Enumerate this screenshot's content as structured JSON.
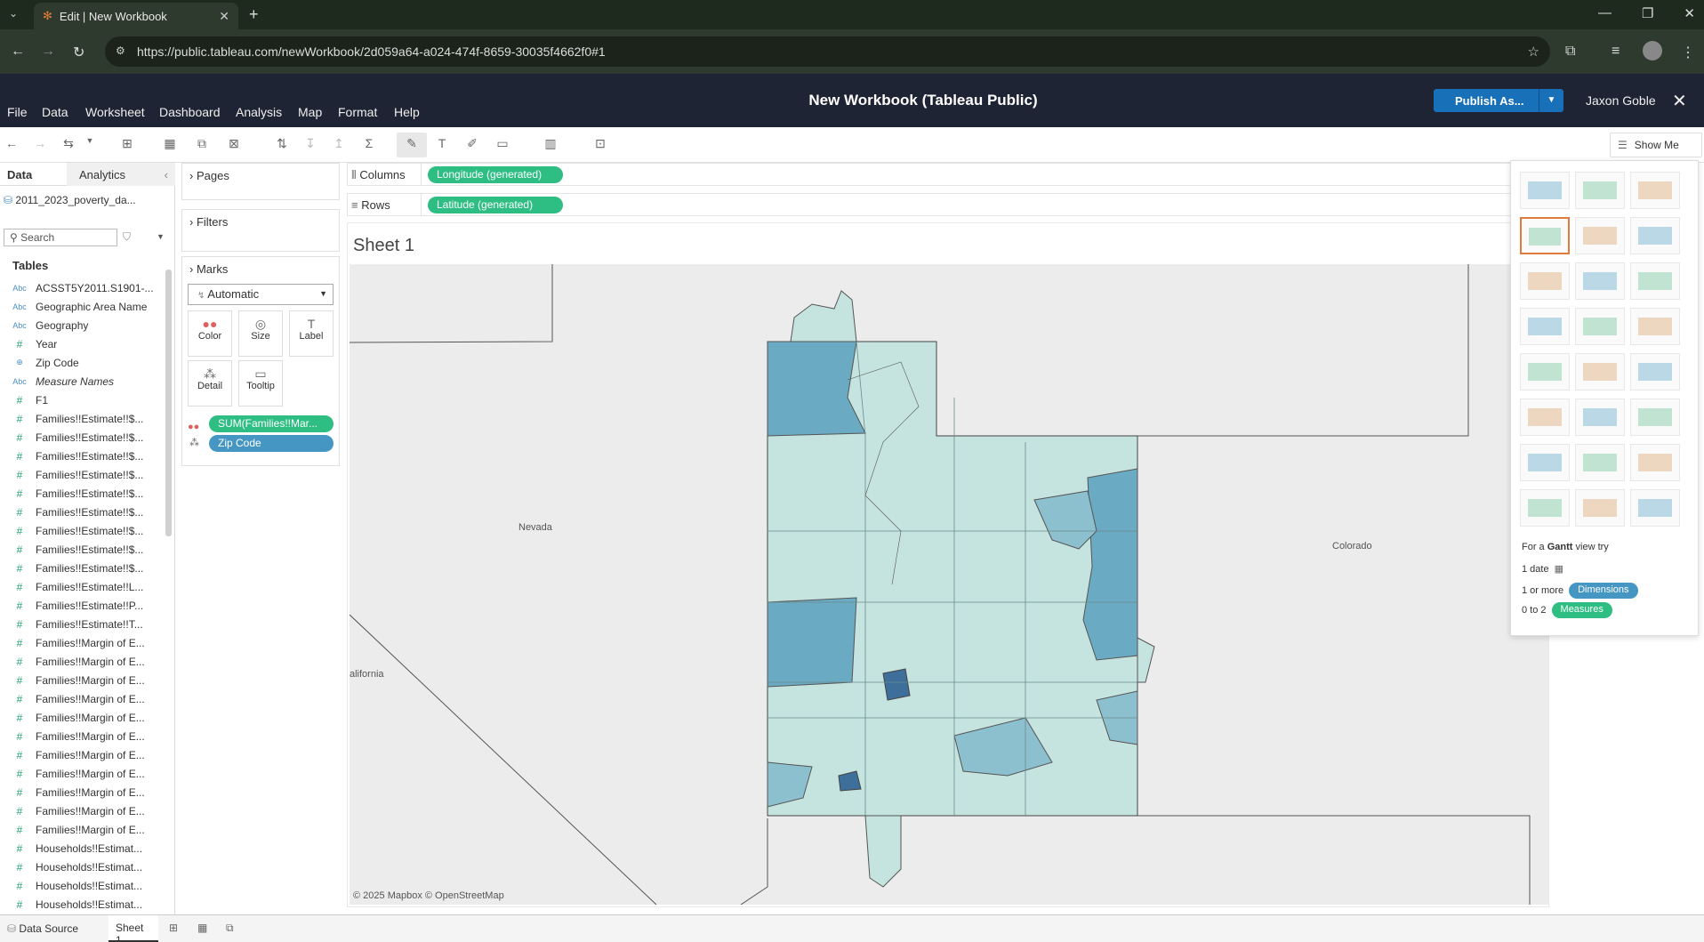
{
  "browser": {
    "tab_title": "Edit | New Workbook",
    "url": "https://public.tableau.com/newWorkbook/2d059a64-a024-474f-8659-30035f4662f0#1"
  },
  "header": {
    "menus": [
      "File",
      "Data",
      "Worksheet",
      "Dashboard",
      "Analysis",
      "Map",
      "Format",
      "Help"
    ],
    "title": "New Workbook (Tableau Public)",
    "publish_label": "Publish As...",
    "user": "Jaxon Goble"
  },
  "toolbar": {
    "show_me_label": "Show Me"
  },
  "data_pane": {
    "data_tab": "Data",
    "analytics_tab": "Analytics",
    "datasource": "2011_2023_poverty_da...",
    "search_placeholder": "Search",
    "tables_heading": "Tables",
    "fields": [
      {
        "type": "Abc",
        "name": "ACSST5Y2011.S1901-..."
      },
      {
        "type": "Abc",
        "name": "Geographic Area Name"
      },
      {
        "type": "Abc",
        "name": "Geography"
      },
      {
        "type": "#",
        "name": "Year"
      },
      {
        "type": "⊕",
        "name": "Zip Code"
      },
      {
        "type": "Abc",
        "name": "Measure Names"
      },
      {
        "type": "#",
        "name": "F1"
      },
      {
        "type": "#",
        "name": "Families!!Estimate!!$..."
      },
      {
        "type": "#",
        "name": "Families!!Estimate!!$..."
      },
      {
        "type": "#",
        "name": "Families!!Estimate!!$..."
      },
      {
        "type": "#",
        "name": "Families!!Estimate!!$..."
      },
      {
        "type": "#",
        "name": "Families!!Estimate!!$..."
      },
      {
        "type": "#",
        "name": "Families!!Estimate!!$..."
      },
      {
        "type": "#",
        "name": "Families!!Estimate!!$..."
      },
      {
        "type": "#",
        "name": "Families!!Estimate!!$..."
      },
      {
        "type": "#",
        "name": "Families!!Estimate!!$..."
      },
      {
        "type": "#",
        "name": "Families!!Estimate!!L..."
      },
      {
        "type": "#",
        "name": "Families!!Estimate!!P..."
      },
      {
        "type": "#",
        "name": "Families!!Estimate!!T..."
      },
      {
        "type": "#",
        "name": "Families!!Margin of E..."
      },
      {
        "type": "#",
        "name": "Families!!Margin of E..."
      },
      {
        "type": "#",
        "name": "Families!!Margin of E..."
      },
      {
        "type": "#",
        "name": "Families!!Margin of E..."
      },
      {
        "type": "#",
        "name": "Families!!Margin of E..."
      },
      {
        "type": "#",
        "name": "Families!!Margin of E..."
      },
      {
        "type": "#",
        "name": "Families!!Margin of E..."
      },
      {
        "type": "#",
        "name": "Families!!Margin of E..."
      },
      {
        "type": "#",
        "name": "Families!!Margin of E..."
      },
      {
        "type": "#",
        "name": "Families!!Margin of E..."
      },
      {
        "type": "#",
        "name": "Families!!Margin of E..."
      },
      {
        "type": "#",
        "name": "Households!!Estimat..."
      },
      {
        "type": "#",
        "name": "Households!!Estimat..."
      },
      {
        "type": "#",
        "name": "Households!!Estimat..."
      },
      {
        "type": "#",
        "name": "Households!!Estimat..."
      }
    ]
  },
  "cards": {
    "pages": "Pages",
    "filters": "Filters",
    "marks": "Marks",
    "mark_type": "Automatic",
    "buttons": {
      "color": "Color",
      "size": "Size",
      "label": "Label",
      "detail": "Detail",
      "tooltip": "Tooltip"
    },
    "color_pill": "SUM(Families!!Mar...",
    "detail_pill": "Zip Code"
  },
  "shelves": {
    "columns_label": "Columns",
    "columns_pill": "Longitude (generated)",
    "rows_label": "Rows",
    "rows_pill": "Latitude (generated)"
  },
  "view": {
    "sheet_title": "Sheet 1",
    "labels": {
      "nevada": "Nevada",
      "colorado": "Colorado",
      "california": "alifornia"
    },
    "attribution": "© 2025 Mapbox  © OpenStreetMap"
  },
  "show_me": {
    "hint_prefix": "For a ",
    "hint_bold": "Gantt",
    "hint_suffix": " view try",
    "row1": "1 date",
    "row2_prefix": "1 or more",
    "row2_pill": "Dimensions",
    "row3_prefix": "0 to 2",
    "row3_pill": "Measures"
  },
  "bottom": {
    "data_source": "Data Source",
    "sheet": "Sheet 1"
  },
  "colors": {
    "accent_green": "#2ebd82",
    "accent_blue": "#4696c4",
    "header_bg": "#1e2433",
    "publish": "#1770b8"
  }
}
